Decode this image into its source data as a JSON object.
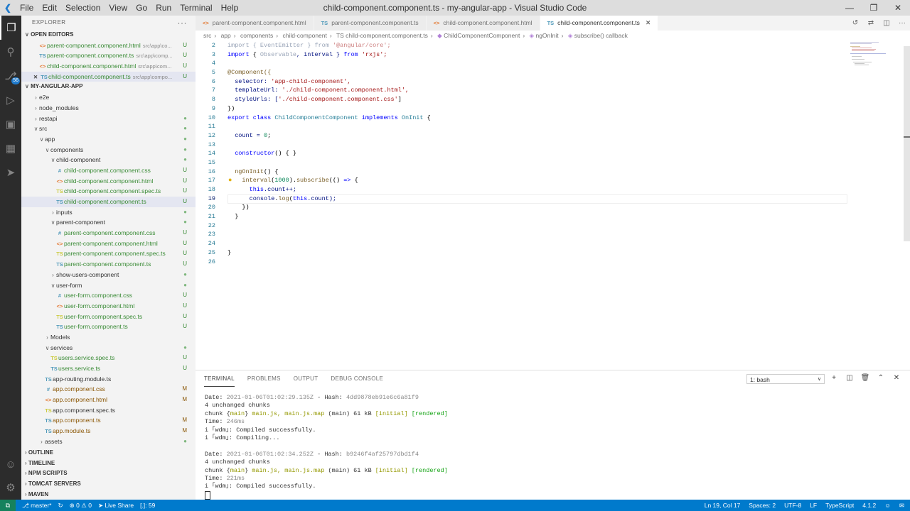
{
  "titlebar": {
    "menu": [
      "File",
      "Edit",
      "Selection",
      "View",
      "Go",
      "Run",
      "Terminal",
      "Help"
    ],
    "title": "child-component.component.ts - my-angular-app - Visual Studio Code"
  },
  "sidebar": {
    "header": "EXPLORER",
    "open_editors_title": "OPEN EDITORS",
    "open_editors": [
      {
        "icon": "<>",
        "name": "parent-component.component.html",
        "path": "src\\app\\co...",
        "status": "U"
      },
      {
        "icon": "TS",
        "name": "parent-component.component.ts",
        "path": "src\\app\\comp...",
        "status": "U"
      },
      {
        "icon": "<>",
        "name": "child-component.component.html",
        "path": "src\\app\\com...",
        "status": "U"
      },
      {
        "icon": "TS",
        "name": "child-component.component.ts",
        "path": "src\\app\\compo...",
        "status": "U"
      }
    ],
    "project_title": "MY-ANGULAR-APP",
    "tree": [
      {
        "label": "e2e",
        "kind": "folder"
      },
      {
        "label": "node_modules",
        "kind": "folder"
      },
      {
        "label": "restapi",
        "kind": "folder"
      },
      {
        "label": "src",
        "kind": "folder"
      },
      {
        "label": "app",
        "kind": "folder"
      },
      {
        "label": "components",
        "kind": "folder"
      },
      {
        "label": "child-component",
        "kind": "folder"
      },
      {
        "label": "child-component.component.css",
        "kind": "css",
        "status": "U"
      },
      {
        "label": "child-component.component.html",
        "kind": "html",
        "status": "U"
      },
      {
        "label": "child-component.component.spec.ts",
        "kind": "spec",
        "status": "U"
      },
      {
        "label": "child-component.component.ts",
        "kind": "ts",
        "status": "U"
      },
      {
        "label": "inputs",
        "kind": "folder"
      },
      {
        "label": "parent-component",
        "kind": "folder"
      },
      {
        "label": "parent-component.component.css",
        "kind": "css",
        "status": "U"
      },
      {
        "label": "parent-component.component.html",
        "kind": "html",
        "status": "U"
      },
      {
        "label": "parent-component.component.spec.ts",
        "kind": "spec",
        "status": "U"
      },
      {
        "label": "parent-component.component.ts",
        "kind": "ts",
        "status": "U"
      },
      {
        "label": "show-users-component",
        "kind": "folder"
      },
      {
        "label": "user-form",
        "kind": "folder"
      },
      {
        "label": "user-form.component.css",
        "kind": "css",
        "status": "U"
      },
      {
        "label": "user-form.component.html",
        "kind": "html",
        "status": "U"
      },
      {
        "label": "user-form.component.spec.ts",
        "kind": "spec",
        "status": "U"
      },
      {
        "label": "user-form.component.ts",
        "kind": "ts",
        "status": "U"
      },
      {
        "label": "Models",
        "kind": "folder"
      },
      {
        "label": "services",
        "kind": "folder"
      },
      {
        "label": "users.service.spec.ts",
        "kind": "spec",
        "status": "U"
      },
      {
        "label": "users.service.ts",
        "kind": "ts",
        "status": "U"
      },
      {
        "label": "app-routing.module.ts",
        "kind": "ts"
      },
      {
        "label": "app.component.css",
        "kind": "css",
        "status": "M"
      },
      {
        "label": "app.component.html",
        "kind": "html",
        "status": "M"
      },
      {
        "label": "app.component.spec.ts",
        "kind": "spec"
      },
      {
        "label": "app.component.ts",
        "kind": "ts",
        "status": "M"
      },
      {
        "label": "app.module.ts",
        "kind": "ts",
        "status": "M"
      },
      {
        "label": "assets",
        "kind": "folder"
      }
    ],
    "bottom_sections": [
      "OUTLINE",
      "TIMELINE",
      "NPM SCRIPTS",
      "TOMCAT SERVERS",
      "MAVEN"
    ]
  },
  "tabs": [
    {
      "icon": "<>",
      "label": "parent-component.component.html"
    },
    {
      "icon": "TS",
      "label": "parent-component.component.ts"
    },
    {
      "icon": "<>",
      "label": "child-component.component.html"
    },
    {
      "icon": "TS",
      "label": "child-component.component.ts"
    }
  ],
  "breadcrumb": [
    "src",
    "app",
    "components",
    "child-component",
    "TS child-component.component.ts",
    "ChildComponentComponent",
    "ngOnInit",
    "subscribe() callback"
  ],
  "code": {
    "line_numbers": [
      "2",
      "3",
      "4",
      "5",
      "6",
      "7",
      "8",
      "9",
      "10",
      "11",
      "12",
      "13",
      "14",
      "15",
      "16",
      "17",
      "18",
      "19",
      "20",
      "21",
      "22",
      "23",
      "24",
      "25",
      "26"
    ],
    "l2": [
      "import",
      " { ",
      "EventEmitter",
      " } ",
      "from",
      " '@angular/core';"
    ],
    "l3": [
      "import",
      " { ",
      "Observable",
      ", interval } ",
      "from",
      " 'rxjs';"
    ],
    "l5": "@Component({",
    "l6": [
      "  selector: ",
      "'app-child-component',"
    ],
    "l7": [
      "  templateUrl: ",
      "'./child-component.component.html',"
    ],
    "l8": [
      "  styleUrls: [",
      "'./child-component.component.css'",
      "]"
    ],
    "l9": "})",
    "l10": [
      "export",
      " ",
      "class",
      " ",
      "ChildComponentComponent",
      " ",
      "implements",
      " ",
      "OnInit",
      " {"
    ],
    "l12": [
      "  count = ",
      "0",
      ";"
    ],
    "l14": [
      "  constructor",
      "() { }"
    ],
    "l16": [
      "  ngOnInit",
      "() {"
    ],
    "l17": [
      "    interval",
      "(",
      "1000",
      ").",
      "subscribe",
      "(() ",
      "=>",
      " {"
    ],
    "l18": [
      "      this",
      ".count++;"
    ],
    "l19": [
      "      console",
      ".",
      "log",
      "(",
      "this",
      ".count);"
    ],
    "l20": "    })",
    "l21": "  }",
    "l25": "}"
  },
  "panel": {
    "tabs": [
      "TERMINAL",
      "PROBLEMS",
      "OUTPUT",
      "DEBUG CONSOLE"
    ],
    "terminal_select": "1: bash",
    "block1": {
      "date": "Date: ",
      "date_val": "2021-01-06T01:02:29.135Z",
      "hash": " - Hash: ",
      "hash_val": "4dd9878eb91e6c6a81f9",
      "unchanged": "4 unchanged chunks",
      "chunk_pre": "chunk {",
      "chunk_main": "main",
      "chunk_mid": "} ",
      "chunk_files": "main.js, main.js.map",
      "chunk_size": " (main) 61 kB ",
      "initial": "[initial]",
      "rendered": "[rendered]",
      "time": "Time: ",
      "time_val": "246ms",
      "compiled": "i ｢wdm｣: Compiled successfully.",
      "compiling": "i ｢wdm｣: Compiling..."
    },
    "block2": {
      "date": "Date: ",
      "date_val": "2021-01-06T01:02:34.252Z",
      "hash": " - Hash: ",
      "hash_val": "b9246f4af25797dbd1f4",
      "unchanged": "4 unchanged chunks",
      "chunk_pre": "chunk {",
      "chunk_main": "main",
      "chunk_mid": "} ",
      "chunk_files": "main.js, main.js.map",
      "chunk_size": " (main) 61 kB ",
      "initial": "[initial]",
      "rendered": "[rendered]",
      "time": "Time: ",
      "time_val": "221ms",
      "compiled": "i ｢wdm｣: Compiled successfully."
    }
  },
  "statusbar": {
    "branch": "master*",
    "errors": "0",
    "warnings": "0",
    "liveshare": "Live Share",
    "selection": "[.]: 59",
    "position": "Ln 19, Col 17",
    "spaces": "Spaces: 2",
    "encoding": "UTF-8",
    "eol": "LF",
    "language": "TypeScript",
    "version": "4.1.2"
  },
  "colors": {
    "accent": "#007acc",
    "activity_bg": "#2c2c2c",
    "sidebar_bg": "#f3f3f3",
    "untracked": "#388a34",
    "modified": "#895503"
  }
}
